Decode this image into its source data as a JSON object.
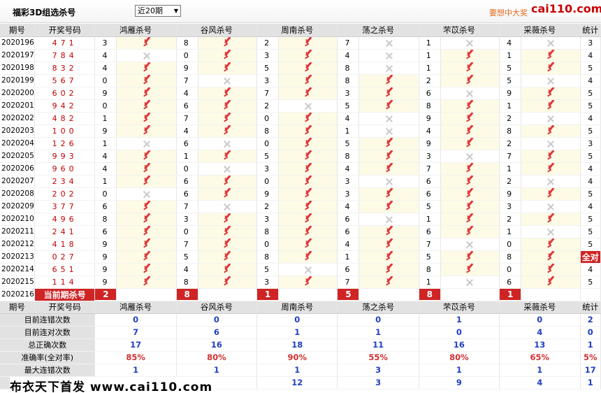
{
  "header": {
    "title": "福彩3D组选杀号",
    "period_select": "近20期",
    "promo": "要想中大奖",
    "logo": "cai110.com"
  },
  "columns": {
    "period": "期号",
    "draw": "开奖号码",
    "experts": [
      "鸿雁杀号",
      "谷风杀号",
      "周南杀号",
      "荡之杀号",
      "芣苡杀号",
      "采薇杀号"
    ],
    "total": "统计"
  },
  "rows": [
    {
      "period": "2020196",
      "draw": "471",
      "kills": [
        [
          3,
          1
        ],
        [
          8,
          1
        ],
        [
          2,
          1
        ],
        [
          7,
          0
        ],
        [
          1,
          0
        ],
        [
          4,
          0
        ]
      ],
      "total": 3
    },
    {
      "period": "2020197",
      "draw": "784",
      "kills": [
        [
          4,
          0
        ],
        [
          0,
          1
        ],
        [
          3,
          1
        ],
        [
          4,
          0
        ],
        [
          1,
          1
        ],
        [
          1,
          1
        ]
      ],
      "total": 4
    },
    {
      "period": "2020198",
      "draw": "832",
      "kills": [
        [
          4,
          1
        ],
        [
          9,
          1
        ],
        [
          5,
          1
        ],
        [
          8,
          0
        ],
        [
          1,
          1
        ],
        [
          5,
          1
        ]
      ],
      "total": 5
    },
    {
      "period": "2020199",
      "draw": "567",
      "kills": [
        [
          0,
          1
        ],
        [
          7,
          0
        ],
        [
          3,
          1
        ],
        [
          8,
          1
        ],
        [
          2,
          1
        ],
        [
          5,
          0
        ]
      ],
      "total": 4
    },
    {
      "period": "2020200",
      "draw": "602",
      "kills": [
        [
          9,
          1
        ],
        [
          4,
          1
        ],
        [
          7,
          1
        ],
        [
          3,
          1
        ],
        [
          6,
          0
        ],
        [
          9,
          1
        ]
      ],
      "total": 5
    },
    {
      "period": "2020201",
      "draw": "942",
      "kills": [
        [
          0,
          1
        ],
        [
          6,
          1
        ],
        [
          2,
          0
        ],
        [
          5,
          1
        ],
        [
          8,
          1
        ],
        [
          1,
          1
        ]
      ],
      "total": 5
    },
    {
      "period": "2020202",
      "draw": "482",
      "kills": [
        [
          1,
          1
        ],
        [
          7,
          1
        ],
        [
          0,
          1
        ],
        [
          4,
          0
        ],
        [
          9,
          1
        ],
        [
          2,
          0
        ]
      ],
      "total": 4
    },
    {
      "period": "2020203",
      "draw": "100",
      "kills": [
        [
          9,
          1
        ],
        [
          4,
          1
        ],
        [
          8,
          1
        ],
        [
          1,
          0
        ],
        [
          4,
          1
        ],
        [
          8,
          1
        ]
      ],
      "total": 5
    },
    {
      "period": "2020204",
      "draw": "126",
      "kills": [
        [
          1,
          0
        ],
        [
          6,
          0
        ],
        [
          0,
          1
        ],
        [
          5,
          1
        ],
        [
          9,
          1
        ],
        [
          2,
          0
        ]
      ],
      "total": 3
    },
    {
      "period": "2020205",
      "draw": "993",
      "kills": [
        [
          4,
          1
        ],
        [
          1,
          1
        ],
        [
          5,
          1
        ],
        [
          8,
          1
        ],
        [
          3,
          0
        ],
        [
          7,
          1
        ]
      ],
      "total": 5
    },
    {
      "period": "2020206",
      "draw": "960",
      "kills": [
        [
          4,
          1
        ],
        [
          0,
          0
        ],
        [
          3,
          1
        ],
        [
          4,
          1
        ],
        [
          7,
          1
        ],
        [
          1,
          1
        ]
      ],
      "total": 4
    },
    {
      "period": "2020207",
      "draw": "234",
      "kills": [
        [
          1,
          1
        ],
        [
          6,
          1
        ],
        [
          0,
          1
        ],
        [
          3,
          0
        ],
        [
          6,
          1
        ],
        [
          2,
          0
        ]
      ],
      "total": 4
    },
    {
      "period": "2020208",
      "draw": "202",
      "kills": [
        [
          0,
          0
        ],
        [
          6,
          1
        ],
        [
          9,
          1
        ],
        [
          3,
          1
        ],
        [
          6,
          1
        ],
        [
          9,
          1
        ]
      ],
      "total": 5
    },
    {
      "period": "2020209",
      "draw": "377",
      "kills": [
        [
          6,
          1
        ],
        [
          7,
          0
        ],
        [
          2,
          1
        ],
        [
          4,
          1
        ],
        [
          5,
          1
        ],
        [
          3,
          0
        ]
      ],
      "total": 4
    },
    {
      "period": "2020210",
      "draw": "496",
      "kills": [
        [
          8,
          1
        ],
        [
          3,
          1
        ],
        [
          3,
          1
        ],
        [
          6,
          0
        ],
        [
          1,
          1
        ],
        [
          2,
          1
        ]
      ],
      "total": 5
    },
    {
      "period": "2020211",
      "draw": "241",
      "kills": [
        [
          6,
          1
        ],
        [
          0,
          1
        ],
        [
          8,
          1
        ],
        [
          6,
          1
        ],
        [
          6,
          1
        ],
        [
          1,
          0
        ]
      ],
      "total": 5
    },
    {
      "period": "2020212",
      "draw": "418",
      "kills": [
        [
          9,
          1
        ],
        [
          7,
          1
        ],
        [
          0,
          1
        ],
        [
          4,
          1
        ],
        [
          7,
          0
        ],
        [
          0,
          1
        ]
      ],
      "total": 5
    },
    {
      "period": "2020213",
      "draw": "027",
      "kills": [
        [
          9,
          1
        ],
        [
          5,
          1
        ],
        [
          8,
          1
        ],
        [
          1,
          1
        ],
        [
          5,
          1
        ],
        [
          8,
          1
        ]
      ],
      "total": "全对"
    },
    {
      "period": "2020214",
      "draw": "651",
      "kills": [
        [
          9,
          1
        ],
        [
          4,
          1
        ],
        [
          5,
          0
        ],
        [
          6,
          1
        ],
        [
          8,
          1
        ],
        [
          0,
          1
        ]
      ],
      "total": 4
    },
    {
      "period": "2020215",
      "draw": "114",
      "kills": [
        [
          9,
          1
        ],
        [
          8,
          1
        ],
        [
          3,
          1
        ],
        [
          7,
          1
        ],
        [
          1,
          0
        ],
        [
          6,
          1
        ]
      ],
      "total": 5
    }
  ],
  "current": {
    "period": "2020216",
    "label": "当前期杀号",
    "kills": [
      "2",
      "8",
      "1",
      "5",
      "8",
      "1"
    ]
  },
  "stats": [
    {
      "label": "目前连错次数",
      "values": [
        "0",
        "0",
        "0",
        "0",
        "1",
        "0"
      ],
      "total": "2"
    },
    {
      "label": "目前连对次数",
      "values": [
        "7",
        "6",
        "1",
        "1",
        "0",
        "4"
      ],
      "total": "0"
    },
    {
      "label": "总正确次数",
      "values": [
        "17",
        "16",
        "18",
        "11",
        "16",
        "13"
      ],
      "total": "1"
    },
    {
      "label": "准确率(全对率)",
      "values": [
        "85%",
        "80%",
        "90%",
        "55%",
        "80%",
        "65%"
      ],
      "total": "5%",
      "red": true
    },
    {
      "label": "最大连错次数",
      "values": [
        "1",
        "1",
        "1",
        "3",
        "1",
        "1"
      ],
      "total": "17"
    },
    {
      "label": "",
      "values": [
        "",
        "",
        "12",
        "3",
        "9",
        "4"
      ],
      "total": "1"
    }
  ],
  "footer": "布衣天下首发 www.cai110.com",
  "colors": {
    "accent": "#cf2424",
    "check": "#e0363a",
    "stat_blue": "#1f3fc0",
    "header_bg": "#e2e2e2"
  }
}
